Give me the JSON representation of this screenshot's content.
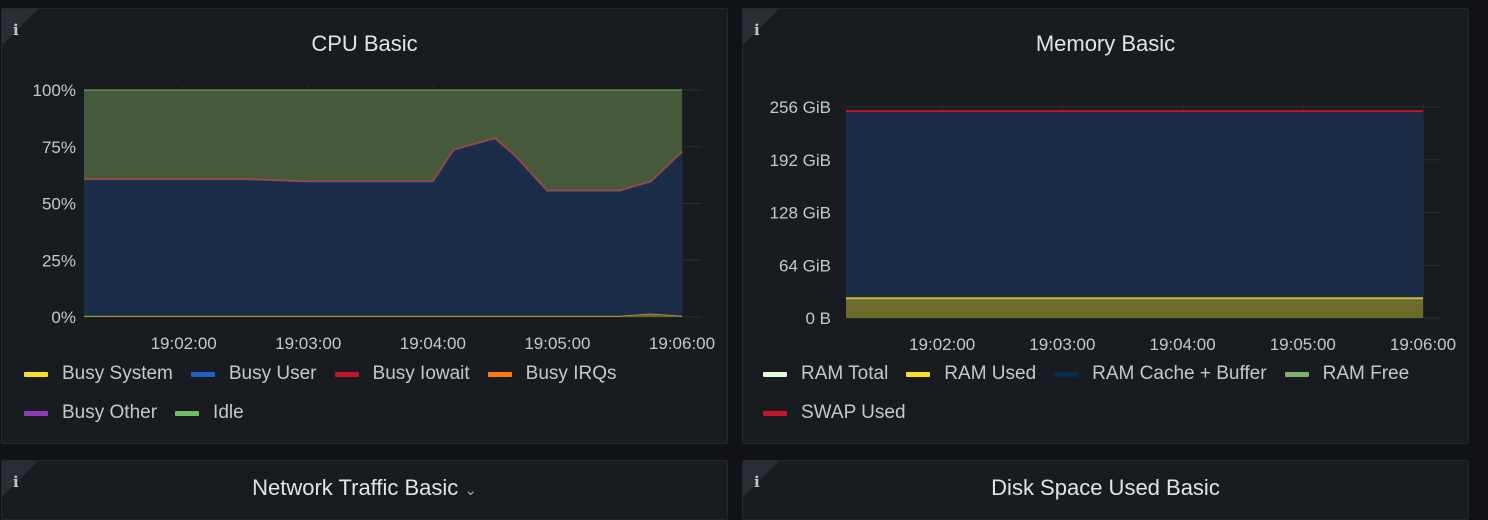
{
  "panels": {
    "cpu": {
      "title": "CPU Basic",
      "info": "i",
      "yticks": [
        "100%",
        "75%",
        "50%",
        "25%",
        "0%"
      ],
      "xticks": [
        "19:02:00",
        "19:03:00",
        "19:04:00",
        "19:05:00",
        "19:06:00"
      ],
      "legend": [
        {
          "label": "Busy System",
          "color": "#fade2a"
        },
        {
          "label": "Busy User",
          "color": "#1f60c4"
        },
        {
          "label": "Busy Iowait",
          "color": "#c4162a"
        },
        {
          "label": "Busy IRQs",
          "color": "#ff780a"
        },
        {
          "label": "Busy Other",
          "color": "#8f3bb8"
        },
        {
          "label": "Idle",
          "color": "#73bf69"
        }
      ]
    },
    "memory": {
      "title": "Memory Basic",
      "info": "i",
      "yticks": [
        "256 GiB",
        "192 GiB",
        "128 GiB",
        "64 GiB",
        "0 B"
      ],
      "xticks": [
        "19:02:00",
        "19:03:00",
        "19:04:00",
        "19:05:00",
        "19:06:00"
      ],
      "legend": [
        {
          "label": "RAM Total",
          "color": "#e0f9d7"
        },
        {
          "label": "RAM Used",
          "color": "#fade2a"
        },
        {
          "label": "RAM Cache + Buffer",
          "color": "#052b51"
        },
        {
          "label": "RAM Free",
          "color": "#7eb26d"
        },
        {
          "label": "SWAP Used",
          "color": "#c4162a"
        }
      ]
    },
    "network": {
      "title": "Network Traffic Basic",
      "info": "i",
      "menu_chevron": "⌄"
    },
    "disk": {
      "title": "Disk Space Used Basic",
      "info": "i"
    }
  },
  "chart_data": [
    {
      "type": "area",
      "title": "CPU Basic",
      "x": [
        "19:01:12",
        "19:01:30",
        "19:02:00",
        "19:02:30",
        "19:03:00",
        "19:03:30",
        "19:04:00",
        "19:04:10",
        "19:04:30",
        "19:04:40",
        "19:04:55",
        "19:05:30",
        "19:05:45",
        "19:06:00"
      ],
      "ylim": [
        0,
        100
      ],
      "stacked": true,
      "series": [
        {
          "name": "Busy System",
          "values": [
            0.5,
            0.5,
            0.5,
            0.5,
            0.5,
            0.5,
            0.5,
            0.5,
            0.5,
            0.5,
            0.5,
            0.5,
            1.5,
            0.5
          ]
        },
        {
          "name": "Busy User",
          "values": [
            60,
            60,
            60,
            60,
            59,
            59,
            59,
            73,
            78,
            70,
            55,
            55,
            58,
            72
          ]
        },
        {
          "name": "Busy Iowait",
          "values": [
            0.3,
            0.3,
            0.3,
            0.3,
            0.3,
            0.3,
            0.3,
            0.3,
            0.3,
            0.3,
            0.3,
            0.3,
            0.3,
            0.3
          ]
        },
        {
          "name": "Busy IRQs",
          "values": [
            0,
            0,
            0,
            0,
            0,
            0,
            0,
            0,
            0,
            0,
            0,
            0,
            0,
            0
          ]
        },
        {
          "name": "Busy Other",
          "values": [
            0,
            0,
            0,
            0,
            0,
            0,
            0,
            0,
            0,
            0,
            0,
            0,
            0,
            0
          ]
        },
        {
          "name": "Idle",
          "values": [
            39.2,
            39.2,
            39.2,
            39.2,
            40.2,
            40.2,
            40.2,
            26.2,
            21.2,
            29.2,
            44.2,
            44.2,
            40.2,
            27.2
          ]
        }
      ]
    },
    {
      "type": "area",
      "title": "Memory Basic",
      "x": [
        "19:01:12",
        "19:06:00"
      ],
      "ylim": [
        0,
        256
      ],
      "series": [
        {
          "name": "RAM Total",
          "values": [
            251,
            251
          ]
        },
        {
          "name": "RAM Used",
          "values": [
            24,
            24
          ]
        },
        {
          "name": "RAM Cache + Buffer",
          "values": [
            227,
            227
          ]
        },
        {
          "name": "RAM Free",
          "values": [
            0,
            0
          ]
        },
        {
          "name": "SWAP Used",
          "values": [
            251,
            251
          ]
        }
      ]
    }
  ]
}
